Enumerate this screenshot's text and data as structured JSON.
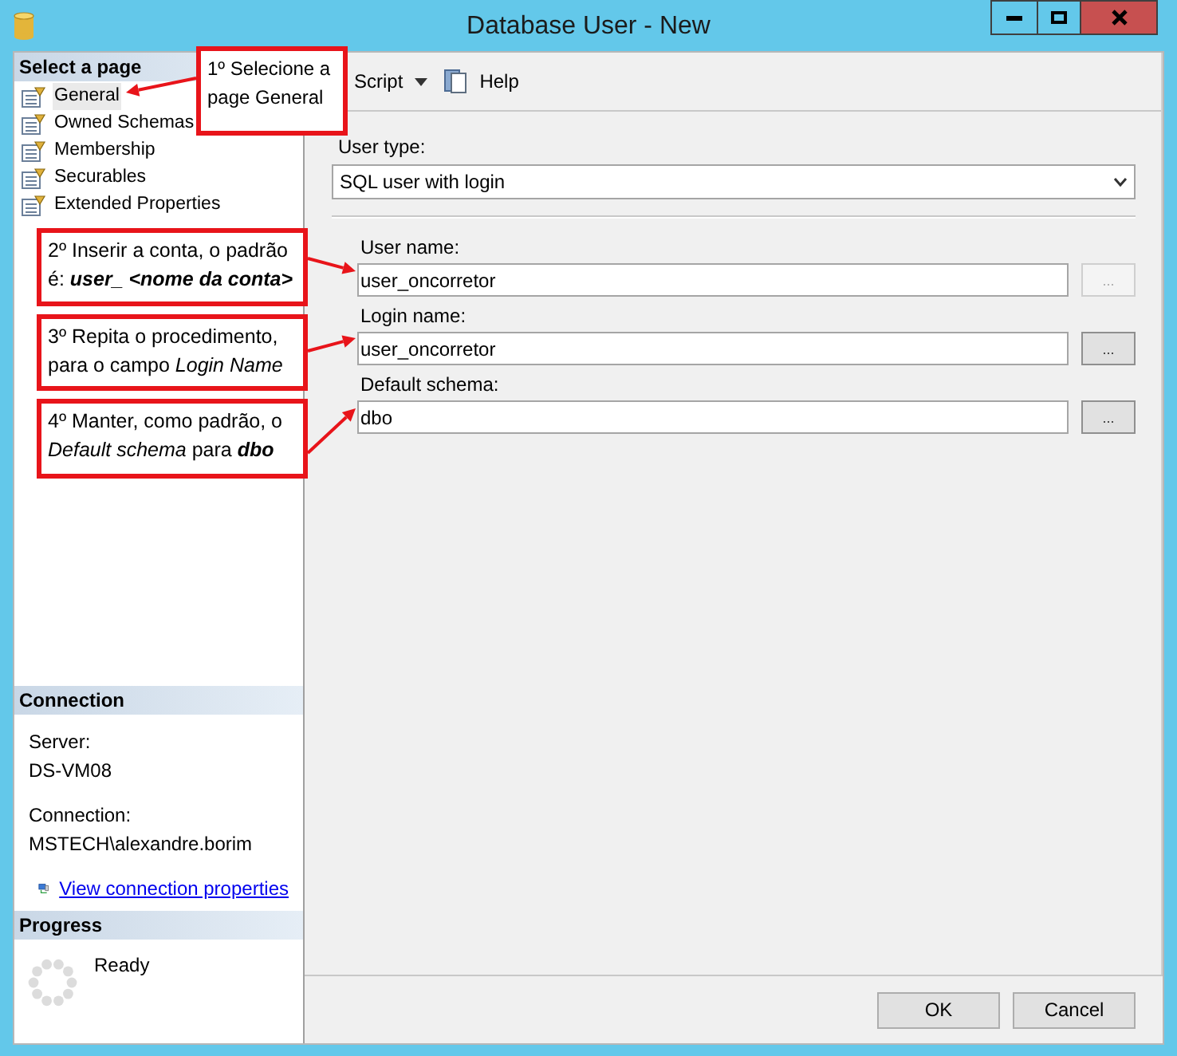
{
  "window": {
    "title": "Database User - New"
  },
  "sidebar": {
    "header": "Select a page",
    "items": [
      {
        "label": "General",
        "selected": true
      },
      {
        "label": "Owned Schemas",
        "selected": false
      },
      {
        "label": "Membership",
        "selected": false
      },
      {
        "label": "Securables",
        "selected": false
      },
      {
        "label": "Extended Properties",
        "selected": false
      }
    ]
  },
  "connection": {
    "header": "Connection",
    "server_label": "Server:",
    "server": "DS-VM08",
    "connection_label": "Connection:",
    "connection": "MSTECH\\alexandre.borim",
    "link": "View connection properties"
  },
  "progress": {
    "header": "Progress",
    "status": "Ready"
  },
  "toolbar": {
    "script": "Script",
    "help": "Help"
  },
  "user_type": {
    "label": "User type:",
    "value": "SQL user with login"
  },
  "fields": [
    {
      "label": "User name:",
      "value": "user_oncorretor",
      "browse": "...",
      "browse_enabled": false
    },
    {
      "label": "Login name:",
      "value": "user_oncorretor",
      "browse": "...",
      "browse_enabled": true
    },
    {
      "label": "Default schema:",
      "value": "dbo",
      "browse": "...",
      "browse_enabled": true
    }
  ],
  "buttons": [
    "OK",
    "Cancel"
  ],
  "annotations": [
    {
      "segments": [
        {
          "text": "1º Selecione a page General",
          "bold": false,
          "italic": false
        }
      ]
    },
    {
      "segments": [
        {
          "text": "2º Inserir a conta, o padrão é: ",
          "bold": false,
          "italic": false
        },
        {
          "text": "user_ <nome da conta>",
          "bold": true,
          "italic": true
        }
      ]
    },
    {
      "segments": [
        {
          "text": "3º Repita o procedimento, para o campo ",
          "bold": false,
          "italic": false
        },
        {
          "text": "Login Name",
          "bold": false,
          "italic": true
        }
      ]
    },
    {
      "segments": [
        {
          "text": "4º Manter, como padrão, o ",
          "bold": false,
          "italic": false
        },
        {
          "text": "Default schema",
          "bold": false,
          "italic": true
        },
        {
          "text": " para ",
          "bold": false,
          "italic": false
        },
        {
          "text": "dbo",
          "bold": true,
          "italic": true
        }
      ]
    }
  ]
}
